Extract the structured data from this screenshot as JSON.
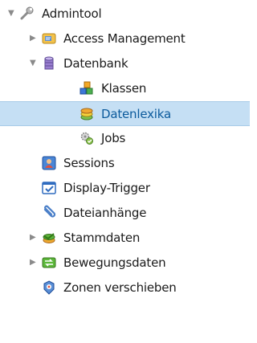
{
  "tree": {
    "root": {
      "label": "Admintool",
      "icon": "wrench-icon",
      "expanded": true
    },
    "access_management": {
      "label": "Access Management",
      "icon": "folder-card-icon",
      "expanded": false
    },
    "datenbank": {
      "label": "Datenbank",
      "icon": "database-icon",
      "expanded": true
    },
    "klassen": {
      "label": "Klassen",
      "icon": "classes-blocks-icon"
    },
    "datenlexika": {
      "label": "Datenlexika",
      "icon": "lexicon-stack-icon",
      "selected": true
    },
    "jobs": {
      "label": "Jobs",
      "icon": "jobs-gears-icon"
    },
    "sessions": {
      "label": "Sessions",
      "icon": "session-user-icon"
    },
    "display_trigger": {
      "label": "Display-Trigger",
      "icon": "display-trigger-icon"
    },
    "dateianhaenge": {
      "label": "Dateianhänge",
      "icon": "paperclip-icon"
    },
    "stammdaten": {
      "label": "Stammdaten",
      "icon": "master-data-icon",
      "expanded": false
    },
    "bewegungsdaten": {
      "label": "Bewegungsdaten",
      "icon": "transaction-data-icon",
      "expanded": false
    },
    "zonen": {
      "label": "Zonen verschieben",
      "icon": "zones-icon"
    }
  },
  "colors": {
    "selection_bg": "#c5dff4",
    "selected_text": "#0b5a9c"
  }
}
